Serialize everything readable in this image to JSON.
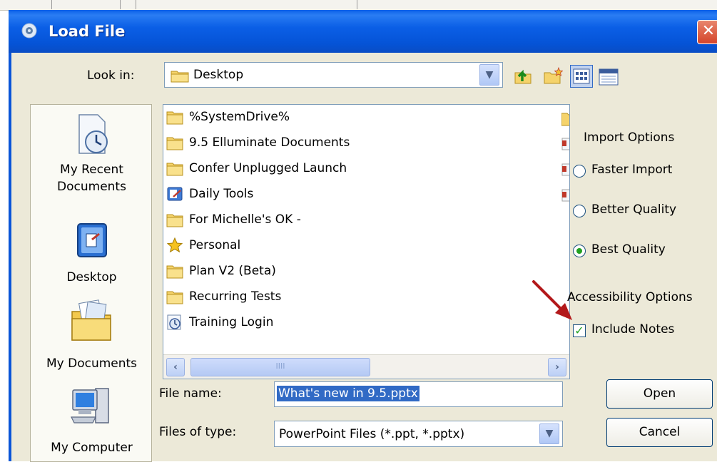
{
  "window": {
    "title": "Load File",
    "close_glyph": "✕"
  },
  "toolbar": {
    "look_in_label": "Look in:",
    "look_in_value": "Desktop",
    "icons": [
      "up-folder-icon",
      "new-folder-icon",
      "list-view-icon",
      "details-view-icon"
    ]
  },
  "places": [
    {
      "label_line1": "My Recent",
      "label_line2": "Documents",
      "icon": "recent-documents-icon"
    },
    {
      "label_line1": "Desktop",
      "label_line2": "",
      "icon": "desktop-icon"
    },
    {
      "label_line1": "My Documents",
      "label_line2": "",
      "icon": "my-documents-icon"
    },
    {
      "label_line1": "My Computer",
      "label_line2": "",
      "icon": "my-computer-icon"
    }
  ],
  "files": [
    {
      "name": "%SystemDrive%",
      "icon": "folder"
    },
    {
      "name": "9.5 Elluminate Documents",
      "icon": "folder"
    },
    {
      "name": "Confer Unplugged Launch",
      "icon": "folder"
    },
    {
      "name": "Daily Tools",
      "icon": "shortcut"
    },
    {
      "name": "For Michelle's OK -",
      "icon": "folder"
    },
    {
      "name": "Personal",
      "icon": "star"
    },
    {
      "name": "Plan V2 (Beta)",
      "icon": "folder"
    },
    {
      "name": "Recurring Tests",
      "icon": "folder"
    },
    {
      "name": "Training Login",
      "icon": "clock"
    }
  ],
  "scrollbar": {
    "thumb_grip": "IIII"
  },
  "import_options": {
    "heading": "Import Options",
    "options": [
      {
        "label": "Faster Import",
        "selected": false
      },
      {
        "label": "Better Quality",
        "selected": false
      },
      {
        "label": "Best Quality",
        "selected": true
      }
    ]
  },
  "accessibility_options": {
    "heading": "Accessibility Options",
    "include_notes_label": "Include Notes",
    "include_notes_checked": true
  },
  "form": {
    "file_name_label": "File name:",
    "file_name_value": "What's new in 9.5.pptx",
    "files_of_type_label": "Files of type:",
    "files_of_type_value": "PowerPoint Files (*.ppt, *.pptx)"
  },
  "buttons": {
    "open": "Open",
    "cancel": "Cancel"
  },
  "colors": {
    "titlebar": "#0553d6",
    "selection": "#316ac5",
    "annotation_arrow": "#b3191b"
  }
}
